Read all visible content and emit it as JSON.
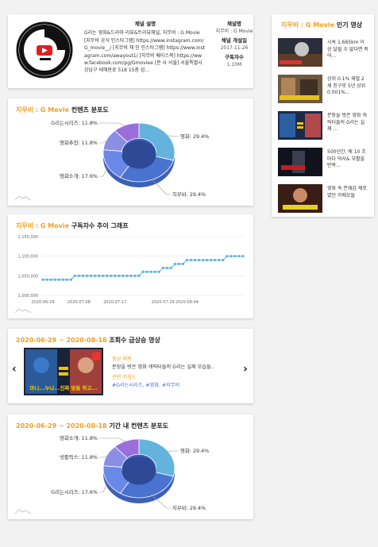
{
  "channel": {
    "desc_heading": "채널 설명",
    "desc_text": "G리는 영화&드라마 리뷰&트리뷰채널, 지무비 : G Movie [지무비 공식 인스타그램] https://www.instagram.com/G_movie__/ [지무비 채 인 인스타그램] https://www.instagram.com/awayout1/ [지무비 페이스북] https://www.facebook.com/pg/Gmoviee [문 사 서울] 서울특별시 강남구 테헤란로 518 15층 섬...",
    "name_label": "채널명",
    "name_value": "지무비 : G Movie",
    "opened_label": "채널 개설일",
    "opened_value": "2017-11-26",
    "subs_label": "구독자수",
    "subs_value": "1.10M"
  },
  "popular": {
    "title_brand": "지무비 : G Movie",
    "title_rest": " 인기 영상",
    "items": [
      {
        "title": "시속 1,665km 이상 달릴 수 없다면 죽어..."
      },
      {
        "title": "상위 0.1% 재벌 2세 친구로 5년 상위 0.001%..."
      },
      {
        "title": "분장을 벗은 영화 캐릭터들의 G리는 실제 ..."
      },
      {
        "title": "500년간, 매 10 조마다 덕사& 부활을 반복..."
      },
      {
        "title": "영화 속 존재감 제로였던 카메오들"
      }
    ]
  },
  "content_dist": {
    "title_brand": "지무비 : G Movie",
    "title_rest": " 컨텐츠 분포도"
  },
  "subs_trend": {
    "title_brand": "지무비 : G Movie",
    "title_rest": " 구독자수 추이 그래프"
  },
  "top_video": {
    "title_range": "2020-06-29 ~ 2020-08-18",
    "title_rest": " 조회수 급상승 영상",
    "video_title_label": "영상 제목",
    "video_title": "분장을 벗은 영화 캐릭터들의 G리는 실제 모습들..",
    "keywords_label": "관련 키워드",
    "keywords": "#G리는시리즈, #영화, #지무비",
    "thumb_caption": "마니...누나...진짜 맞을 하고..."
  },
  "period_dist": {
    "title_range": "2020-06-29 ~ 2020-08-18",
    "title_rest": " 기간 내 컨텐츠 분포도"
  },
  "chart_data": [
    {
      "type": "pie",
      "categories": [
        "영화",
        "지무비",
        "영화소개",
        "영화추천",
        "G리는시리즈"
      ],
      "values": [
        29.4,
        29.4,
        17.6,
        11.8,
        11.8
      ],
      "labels": [
        "영화: 29.4%",
        "지무비: 29.4%",
        "영화소개: 17.6%",
        "영화추천: 11.8%",
        "G리는시리즈: 11.8%"
      ],
      "colors": [
        "#63b3dc",
        "#4a72d0",
        "#6a88e6",
        "#8a8fe4",
        "#9b6fdb"
      ]
    },
    {
      "type": "line",
      "x": [
        "2020-06-29",
        "2020-06-30",
        "2020-07-01",
        "2020-07-02",
        "2020-07-03",
        "2020-07-04",
        "2020-07-05",
        "2020-07-06",
        "2020-07-07",
        "2020-07-08",
        "2020-07-09",
        "2020-07-10",
        "2020-07-11",
        "2020-07-12",
        "2020-07-13",
        "2020-07-14",
        "2020-07-15",
        "2020-07-16",
        "2020-07-17",
        "2020-07-18",
        "2020-07-19",
        "2020-07-20",
        "2020-07-21",
        "2020-07-22",
        "2020-07-23",
        "2020-07-24",
        "2020-07-25",
        "2020-07-26",
        "2020-07-27",
        "2020-07-28",
        "2020-07-29",
        "2020-07-30",
        "2020-07-31",
        "2020-08-01",
        "2020-08-02",
        "2020-08-03",
        "2020-08-04",
        "2020-08-05",
        "2020-08-06",
        "2020-08-07",
        "2020-08-08",
        "2020-08-09",
        "2020-08-10",
        "2020-08-11",
        "2020-08-12",
        "2020-08-13",
        "2020-08-14",
        "2020-08-15",
        "2020-08-16",
        "2020-08-17",
        "2020-08-18"
      ],
      "series": [
        {
          "values": [
            1040000,
            1040000,
            1040000,
            1040000,
            1040000,
            1040000,
            1040000,
            1040000,
            1050000,
            1050000,
            1050000,
            1050000,
            1050000,
            1050000,
            1050000,
            1050000,
            1050000,
            1050000,
            1050000,
            1050000,
            1050000,
            1050000,
            1050000,
            1050000,
            1050000,
            1060000,
            1060000,
            1060000,
            1060000,
            1060000,
            1070000,
            1070000,
            1070000,
            1080000,
            1080000,
            1080000,
            1090000,
            1090000,
            1090000,
            1090000,
            1090000,
            1090000,
            1090000,
            1090000,
            1090000,
            1090000,
            1100000,
            1100000,
            1100000,
            1100000,
            1100000
          ]
        }
      ],
      "xticks": [
        "2020-06-29",
        "2020-07-08",
        "2020-07-17",
        "2020-07-29",
        "2020-08-04"
      ],
      "ylim": [
        1000000,
        1150000
      ],
      "yticks": [
        "1,000,000",
        "1,050,000",
        "1,100,000",
        "1,150,000"
      ],
      "color": "#63b3dc",
      "grid": true
    },
    {
      "type": "pie",
      "categories": [
        "영화",
        "지무비",
        "G리는시리즈",
        "넷플릭스",
        "영화소개"
      ],
      "values": [
        29.4,
        29.4,
        17.6,
        11.8,
        11.8
      ],
      "labels": [
        "영화: 29.4%",
        "지무비: 29.4%",
        "G리는시리즈: 17.6%",
        "넷플릭스: 11.8%",
        "영화소개: 11.8%"
      ],
      "colors": [
        "#63b3dc",
        "#4a72d0",
        "#6a88e6",
        "#8a8fe4",
        "#9b6fdb"
      ]
    }
  ]
}
